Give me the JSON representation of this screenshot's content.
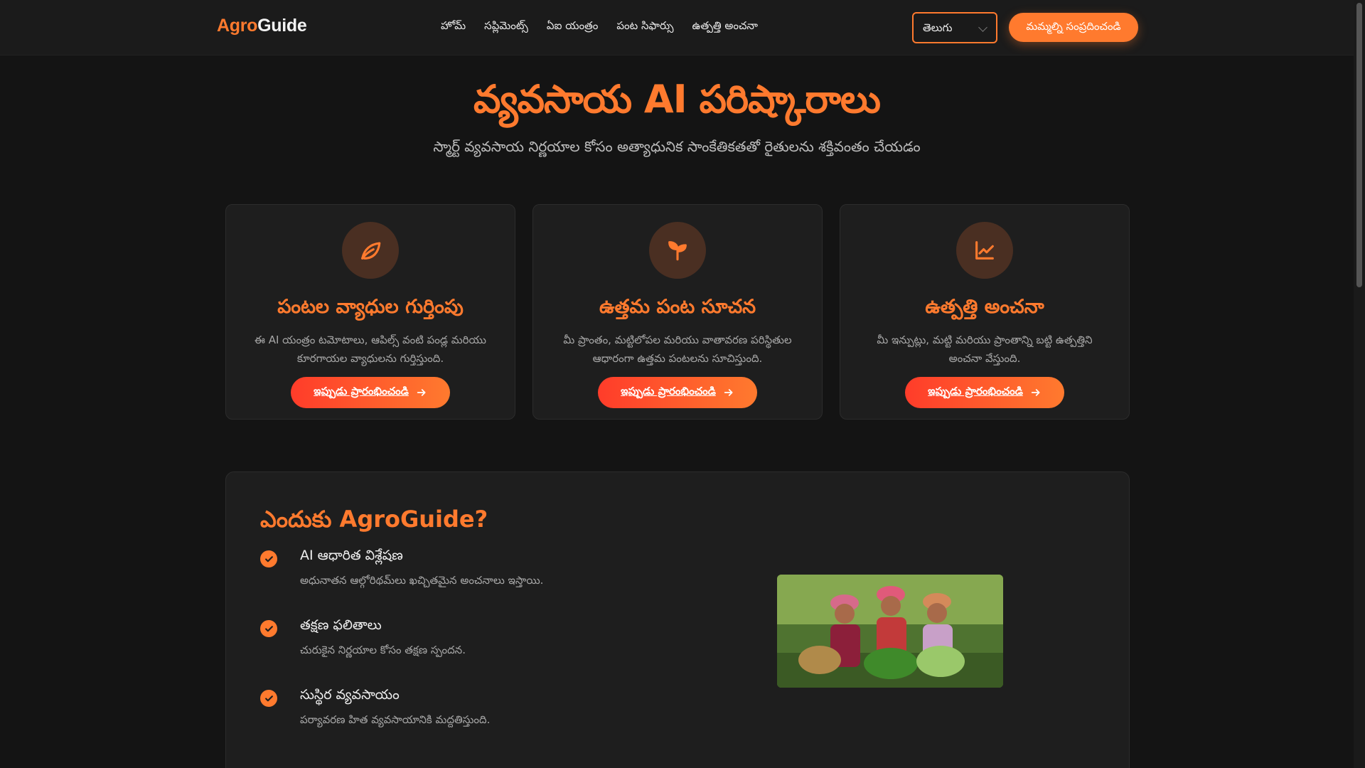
{
  "header": {
    "logo_part1": "Agro",
    "logo_part2": "Guide",
    "nav": [
      "హోమ్",
      "సప్లిమెంట్స్",
      "ఏఐ యంత్రం",
      "పంట సిఫార్సు",
      "ఉత్పత్తి అంచనా"
    ],
    "language": "తెలుగు",
    "contact_label": "మమ్మల్ని సంప్రదించండి"
  },
  "hero": {
    "title": "వ్యవసాయ AI పరిష్కారాలు",
    "subtitle": "స్మార్ట్ వ్యవసాయ నిర్ణయాల కోసం అత్యాధునిక సాంకేతికతతో రైతులను శక్తివంతం చేయడం"
  },
  "cards": [
    {
      "icon": "leaf-icon",
      "title": "పంటల వ్యాధుల గుర్తింపు",
      "desc": "ఈ AI యంత్రం టమోటాలు, ఆపిల్స్ వంటి పండ్ల మరియు కూరగాయల వ్యాధులను గుర్తిస్తుంది.",
      "button": "ఇప్పుడు ప్రారంభించండి"
    },
    {
      "icon": "sprout-icon",
      "title": "ఉత్తమ పంట సూచన",
      "desc": "మీ ప్రాంతం, మట్టిలోపల మరియు వాతావరణ పరిస్థితుల ఆధారంగా ఉత్తమ పంటలను సూచిస్తుంది.",
      "button": "ఇప్పుడు ప్రారంభించండి"
    },
    {
      "icon": "chart-line-icon",
      "title": "ఉత్పత్తి అంచనా",
      "desc": "మీ ఇన్పుట్లు, మట్టి మరియు ప్రాంతాన్ని బట్టి ఉత్పత్తిని అంచనా వేస్తుంది.",
      "button": "ఇప్పుడు ప్రారంభించండి"
    }
  ],
  "why": {
    "title": "ఎందుకు AgroGuide?",
    "features": [
      {
        "title": "AI ఆధారిత విశ్లేషణ",
        "desc": "అధునాతన ఆల్గోరిథమ్‌లు ఖచ్చితమైన అంచనాలు ఇస్తాయి."
      },
      {
        "title": "తక్షణ ఫలితాలు",
        "desc": "చురుకైన నిర్ణయాల కోసం తక్షణ స్పందన."
      },
      {
        "title": "సుస్థిర వ్యవసాయం",
        "desc": "పర్యావరణ హిత వ్యవసాయానికి మద్దతిస్తుంది."
      }
    ]
  },
  "colors": {
    "accent": "#ff7a2e",
    "background": "#141414",
    "card": "#1e1e1e"
  }
}
